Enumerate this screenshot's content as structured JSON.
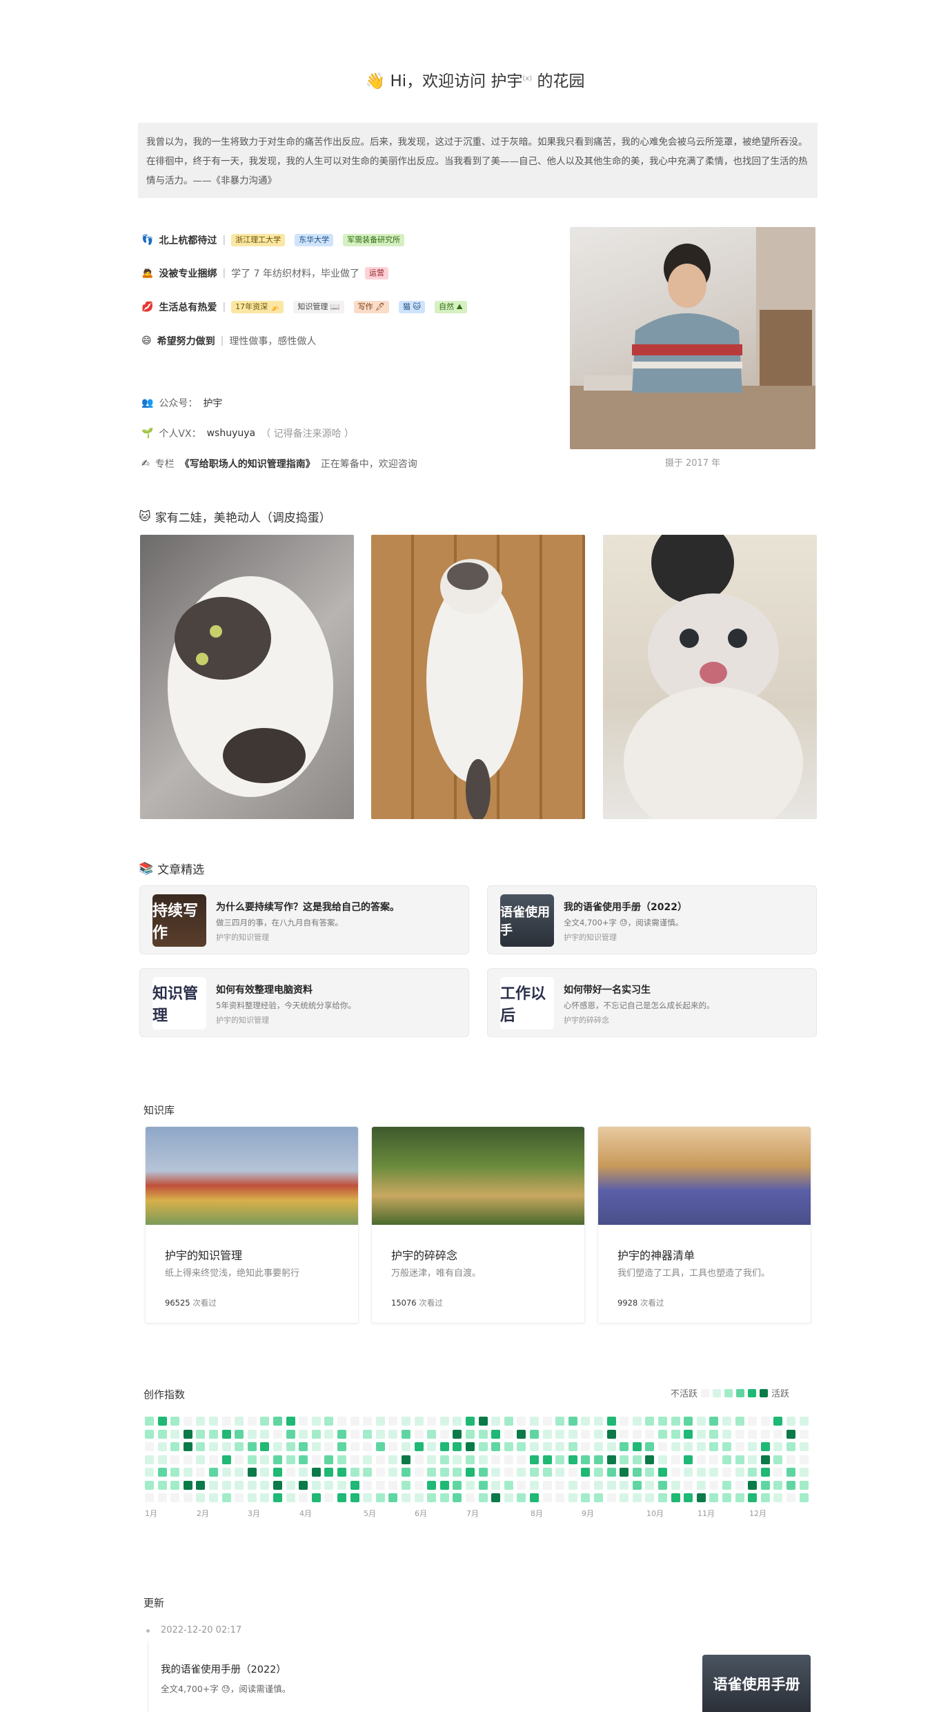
{
  "header": {
    "wave": "👋",
    "title_pre": "Hi，欢迎访问 护宇",
    "title_sup": "(x)",
    "title_post": " 的花园"
  },
  "quote": {
    "text": "我曾以为，我的一生将致力于对生命的痛苦作出反应。后来，我发现，这过于沉重、过于灰暗。如果我只看到痛苦，我的心难免会被乌云所笼罩，被绝望所吞没。在徘徊中，终于有一天，我发现，我的人生可以对生命的美丽作出反应。当我看到了美——自己、他人以及其他生命的美，我心中充满了柔情，也找回了生活的热情与活力。——《非暴力沟通》"
  },
  "about": {
    "row1": {
      "icon": "👣",
      "label": "北上杭都待过",
      "tags": [
        "浙江理工大学",
        "东华大学",
        "军需装备研究所"
      ]
    },
    "row2": {
      "icon": "🙇",
      "label": "没被专业捆绑",
      "text": "学了 7 年纺织材料，毕业做了",
      "tag": "运营"
    },
    "row3": {
      "icon": "💋",
      "label": "生活总有热爱",
      "tags": [
        "17年资深 🍌",
        "知识管理 📖",
        "写作 🖊",
        "猫 🐱",
        "自然 ⛰"
      ]
    },
    "row4": {
      "icon": "😄",
      "label": "希望努力做到",
      "text": "理性做事，感性做人"
    },
    "contact1": {
      "icon": "👥",
      "label": "公众号：",
      "value": "护宇"
    },
    "contact2": {
      "icon": "🌱",
      "label": "个人VX：",
      "value": "wshuyuya",
      "note": "（ 记得备注来源哈 ）"
    },
    "contact3": {
      "icon": "✍",
      "pre": "专栏",
      "title": "《写给职场人的知识管理指南》",
      "post": "正在筹备中，欢迎咨询"
    },
    "photo_caption": "摄于 2017 年"
  },
  "cats": {
    "icon": "🐱",
    "title": "家有二娃，美艳动人（调皮捣蛋）"
  },
  "articles": {
    "icon": "📚",
    "title": "文章精选",
    "items": [
      {
        "thumb": "持续写作",
        "title": "为什么要持续写作？这是我给自己的答案。",
        "desc": "做三四月的事，在八九月自有答案。",
        "source": "护宇的知识管理"
      },
      {
        "thumb": "语雀使用手",
        "title": "我的语雀使用手册（2022）",
        "desc": "全文4,700+字 😓，阅读需谨慎。",
        "source": "护宇的知识管理"
      },
      {
        "thumb": "知识管理",
        "title": "如何有效整理电脑资料",
        "desc": "5年资料整理经验，今天统统分享给你。",
        "source": "护宇的知识管理"
      },
      {
        "thumb": "工作以后",
        "title": "如何带好一名实习生",
        "desc": "心怀感恩，不忘记自己是怎么成长起来的。",
        "source": "护宇的碎碎念"
      }
    ]
  },
  "knowledge": {
    "title": "知识库",
    "items": [
      {
        "title": "护宇的知识管理",
        "desc": "纸上得来终觉浅，绝知此事要躬行",
        "views": "96525",
        "views_suffix": " 次看过"
      },
      {
        "title": "护宇的碎碎念",
        "desc": "万般迷津，唯有自渡。",
        "views": "15076",
        "views_suffix": " 次看过"
      },
      {
        "title": "护宇的神器清单",
        "desc": "我们塑造了工具，工具也塑造了我们。",
        "views": "9928",
        "views_suffix": " 次看过"
      }
    ]
  },
  "activity": {
    "title": "创作指数",
    "legend_low": "不活跃",
    "legend_high": "活跃",
    "months": [
      "1月",
      "2月",
      "3月",
      "4月",
      "5月",
      "6月",
      "7月",
      "8月",
      "9月",
      "10月",
      "11月",
      "12月"
    ],
    "colors": [
      "#f4f4f4",
      "#d7f5e6",
      "#a3ecc9",
      "#5fd6a1",
      "#1fb874",
      "#0b7a48"
    ]
  },
  "updates": {
    "title": "更新",
    "date": "2022-12-20 02:17",
    "item_title": "我的语雀使用手册（2022）",
    "item_desc": "全文4,700+字 😓，阅读需谨慎。",
    "item_thumb": "语雀使用手册"
  }
}
